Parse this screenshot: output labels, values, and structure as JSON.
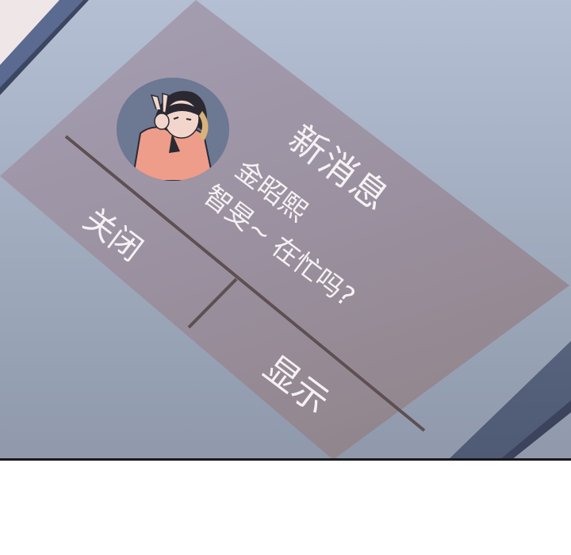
{
  "notification": {
    "title": "新消息",
    "sender": "金昭熙",
    "message": "智旻~ 在忙吗?"
  },
  "buttons": {
    "close_label": "关闭",
    "show_label": "显示"
  },
  "colors": {
    "dialog": "#9a8f9e",
    "screen": "#a9b3c7",
    "frame": "#5a6a90",
    "text": "#f6f2f4"
  }
}
